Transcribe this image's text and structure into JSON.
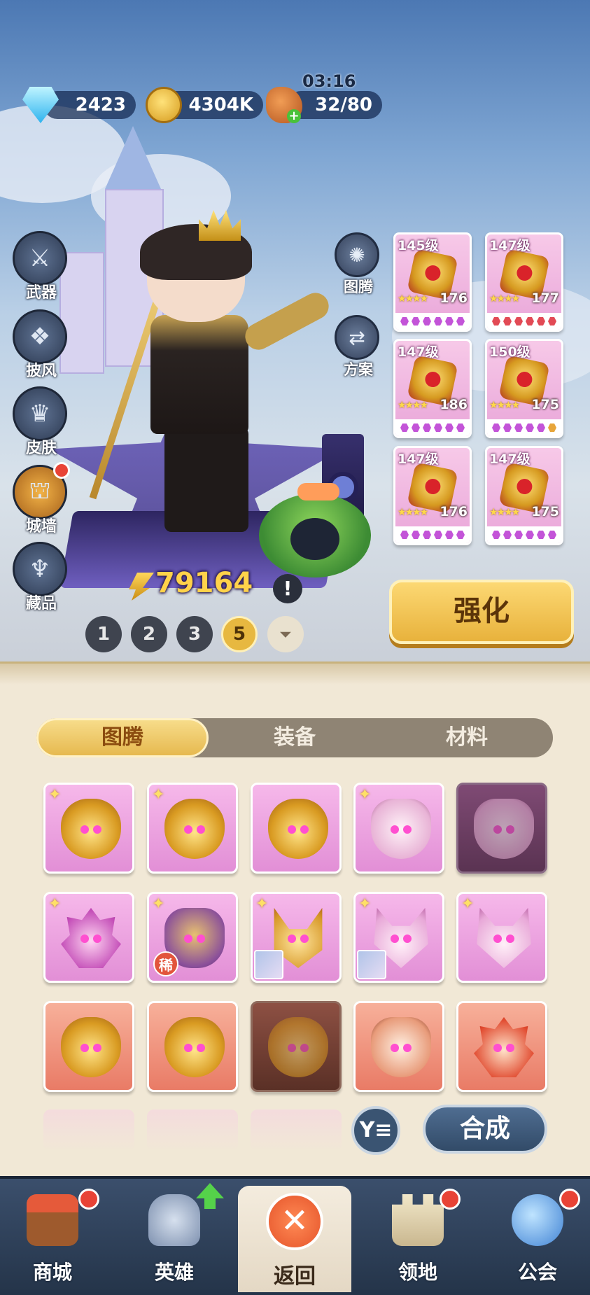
{
  "resources": {
    "gems": "2423",
    "gold": "4304K",
    "stamina": "32/80",
    "timer": "03:16"
  },
  "side_menu": [
    "武器",
    "披风",
    "皮肤",
    "城墙",
    "藏品"
  ],
  "mid_menu": [
    "图腾",
    "方案"
  ],
  "equipment": [
    {
      "level": "145级",
      "score": "176",
      "slot_color": "#c354d8"
    },
    {
      "level": "147级",
      "score": "177",
      "slot_color": "#e24a55"
    },
    {
      "level": "147级",
      "score": "186",
      "slot_color": "#c354d8"
    },
    {
      "level": "150级",
      "score": "175",
      "slot_color": "#c354d8"
    },
    {
      "level": "147级",
      "score": "176",
      "slot_color": "#c354d8"
    },
    {
      "level": "147级",
      "score": "175",
      "slot_color": "#c354d8"
    }
  ],
  "power": "79164",
  "alert_mark": "!",
  "presets": [
    "1",
    "2",
    "3",
    "5"
  ],
  "preset_more": "⏷",
  "enhance_button": "强化",
  "tabs": [
    "图腾",
    "装备",
    "材料"
  ],
  "rare_badge": "稀",
  "totem_grid": [
    {
      "style": "pink",
      "mask": "lion",
      "spark": true
    },
    {
      "style": "pink",
      "mask": "lion",
      "spark": true
    },
    {
      "style": "pink",
      "mask": "lion",
      "spark": false
    },
    {
      "style": "pink",
      "mask": "skull",
      "spark": true
    },
    {
      "style": "dim-pink",
      "mask": "skull",
      "spark": false
    },
    {
      "style": "pink",
      "mask": "crest",
      "spark": true
    },
    {
      "style": "pink",
      "mask": "owl",
      "spark": true,
      "badge": "rare"
    },
    {
      "style": "pink",
      "mask": "fox",
      "spark": true,
      "badge": "avatar"
    },
    {
      "style": "pink",
      "mask": "cat",
      "spark": true,
      "badge": "avatar"
    },
    {
      "style": "pink",
      "mask": "cat",
      "spark": true
    },
    {
      "style": "red",
      "mask": "lion",
      "spark": false
    },
    {
      "style": "red",
      "mask": "lion",
      "spark": false
    },
    {
      "style": "dim-red",
      "mask": "lion",
      "spark": false
    },
    {
      "style": "red",
      "mask": "skull",
      "spark": false
    },
    {
      "style": "red",
      "mask": "crest",
      "spark": false
    }
  ],
  "filter_glyph": "Y≡",
  "synthesize_button": "合成",
  "nav": {
    "shop": "商城",
    "heroes": "英雄",
    "back": "返回",
    "back_glyph": "✕",
    "territory": "领地",
    "guild": "公会"
  },
  "colors": {
    "accent_gold": "#e7b840",
    "badge_red": "#e84336",
    "nav_bg": "#2f4260"
  }
}
